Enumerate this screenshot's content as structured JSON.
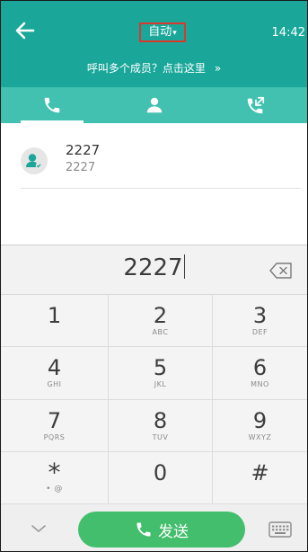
{
  "header": {
    "line_mode": "自动",
    "time": "14:42",
    "conference_hint": "呼叫多个成员？点击这里",
    "conference_hint_arrow": "»"
  },
  "tabs": [
    {
      "icon": "phone-icon",
      "active": true
    },
    {
      "icon": "contacts-icon",
      "active": false
    },
    {
      "icon": "call-history-icon",
      "active": false
    }
  ],
  "results": [
    {
      "name": "2227",
      "number": "2227"
    }
  ],
  "dialed_number": "2227",
  "keypad": [
    {
      "digit": "1",
      "letters": ""
    },
    {
      "digit": "2",
      "letters": "ABC"
    },
    {
      "digit": "3",
      "letters": "DEF"
    },
    {
      "digit": "4",
      "letters": "GHI"
    },
    {
      "digit": "5",
      "letters": "JKL"
    },
    {
      "digit": "6",
      "letters": "MNO"
    },
    {
      "digit": "7",
      "letters": "PQRS"
    },
    {
      "digit": "8",
      "letters": "TUV"
    },
    {
      "digit": "9",
      "letters": "WXYZ"
    },
    {
      "digit": "*",
      "letters": "• @"
    },
    {
      "digit": "0",
      "letters": ""
    },
    {
      "digit": "#",
      "letters": ""
    }
  ],
  "bottom": {
    "send_label": "发送"
  },
  "colors": {
    "header": "#1aa79a",
    "tabs": "#42c1b1",
    "send": "#43be6c",
    "highlight_box": "#d63a2d"
  }
}
